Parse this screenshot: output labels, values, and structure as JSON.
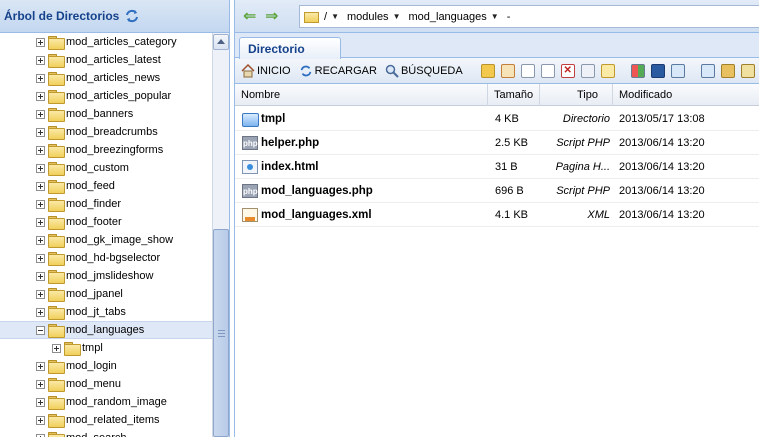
{
  "left_panel": {
    "title": "Árbol de Directorios",
    "tree": [
      {
        "label": "mod_articles_category",
        "expanded": false
      },
      {
        "label": "mod_articles_latest",
        "expanded": false
      },
      {
        "label": "mod_articles_news",
        "expanded": false
      },
      {
        "label": "mod_articles_popular",
        "expanded": false
      },
      {
        "label": "mod_banners",
        "expanded": false
      },
      {
        "label": "mod_breadcrumbs",
        "expanded": false
      },
      {
        "label": "mod_breezingforms",
        "expanded": false
      },
      {
        "label": "mod_custom",
        "expanded": false
      },
      {
        "label": "mod_feed",
        "expanded": false
      },
      {
        "label": "mod_finder",
        "expanded": false
      },
      {
        "label": "mod_footer",
        "expanded": false
      },
      {
        "label": "mod_gk_image_show",
        "expanded": false
      },
      {
        "label": "mod_hd-bgselector",
        "expanded": false
      },
      {
        "label": "mod_jmslideshow",
        "expanded": false
      },
      {
        "label": "mod_jpanel",
        "expanded": false
      },
      {
        "label": "mod_jt_tabs",
        "expanded": false
      },
      {
        "label": "mod_languages",
        "expanded": true,
        "selected": true
      },
      {
        "label": "tmpl",
        "expanded": false,
        "child": true
      },
      {
        "label": "mod_login",
        "expanded": false
      },
      {
        "label": "mod_menu",
        "expanded": false
      },
      {
        "label": "mod_random_image",
        "expanded": false
      },
      {
        "label": "mod_related_items",
        "expanded": false
      },
      {
        "label": "mod_search",
        "expanded": false
      }
    ]
  },
  "address_bar": {
    "segments": [
      "/",
      "modules",
      "mod_languages"
    ],
    "trailing": "-"
  },
  "tabs": {
    "active": "Directorio"
  },
  "toolbar": {
    "home": "INICIO",
    "reload": "RECARGAR",
    "search": "BÚSQUEDA"
  },
  "grid": {
    "columns": {
      "name": "Nombre",
      "size": "Tamaño",
      "type": "Tipo",
      "modified": "Modificado"
    },
    "rows": [
      {
        "name": "tmpl",
        "size": "4 KB",
        "type": "Directorio",
        "modified": "2013/05/17 13:08",
        "icon": "folder"
      },
      {
        "name": "helper.php",
        "size": "2.5 KB",
        "type": "Script PHP",
        "modified": "2013/06/14 13:20",
        "icon": "php"
      },
      {
        "name": "index.html",
        "size": "31 B",
        "type": "Pagina H...",
        "modified": "2013/06/14 13:20",
        "icon": "html"
      },
      {
        "name": "mod_languages.php",
        "size": "696 B",
        "type": "Script PHP",
        "modified": "2013/06/14 13:20",
        "icon": "php"
      },
      {
        "name": "mod_languages.xml",
        "size": "4.1 KB",
        "type": "XML",
        "modified": "2013/06/14 13:20",
        "icon": "xml"
      }
    ]
  },
  "colors": {
    "accent": "#15428b",
    "border": "#99bbe8",
    "selection": "#dfe8f6"
  }
}
